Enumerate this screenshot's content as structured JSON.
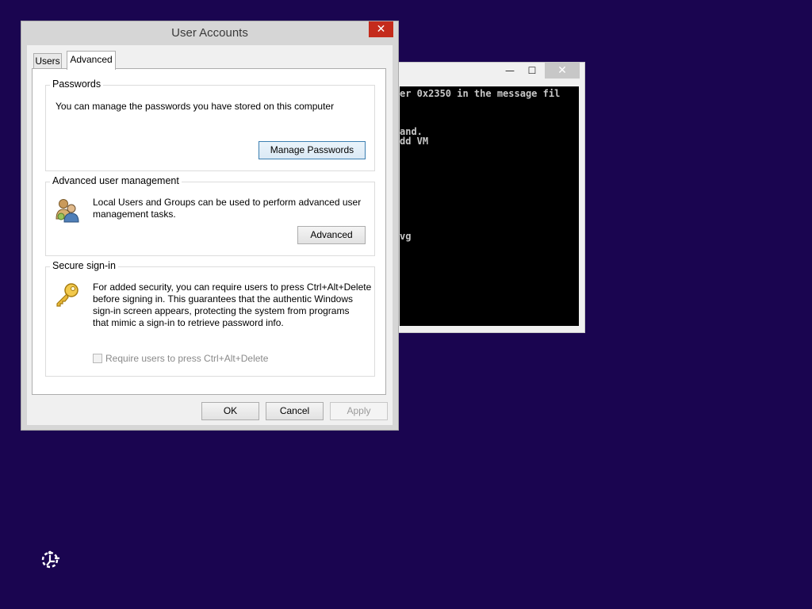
{
  "console": {
    "minimize_glyph": "—",
    "maximize_glyph": "☐",
    "close_glyph": "✕",
    "lines": [
      "er 0x2350 in the message fil",
      "and.",
      "dd VM",
      "vg"
    ]
  },
  "dialog": {
    "title": "User Accounts",
    "close_glyph": "✕",
    "tabs": [
      {
        "label": "Users",
        "selected": false
      },
      {
        "label": "Advanced",
        "selected": true
      }
    ],
    "passwords": {
      "group_label": "Passwords",
      "description": "You can manage the passwords you have stored on this computer",
      "button_label": "Manage Passwords"
    },
    "advanced_user_management": {
      "group_label": "Advanced user management",
      "description_line1": "Local Users and Groups can be used to perform advanced user",
      "description_line2": "management tasks.",
      "button_label": "Advanced",
      "icon": "users-group-icon"
    },
    "secure_sign_in": {
      "group_label": "Secure sign-in",
      "description_line1": "For added security, you can require users to press Ctrl+Alt+Delete",
      "description_line2": "before signing in. This guarantees that the authentic Windows",
      "description_line3": "sign-in screen appears, protecting the system from programs",
      "description_line4": "that mimic a sign-in to retrieve password info.",
      "checkbox_label": "Require users to press Ctrl+Alt+Delete",
      "checkbox_checked": false,
      "checkbox_enabled": false,
      "icon": "key-icon"
    },
    "buttons": {
      "ok": "OK",
      "cancel": "Cancel",
      "apply": "Apply"
    }
  },
  "desktop": {
    "background_color": "#1a0550",
    "bottom_icon": "ease-of-access-icon"
  }
}
